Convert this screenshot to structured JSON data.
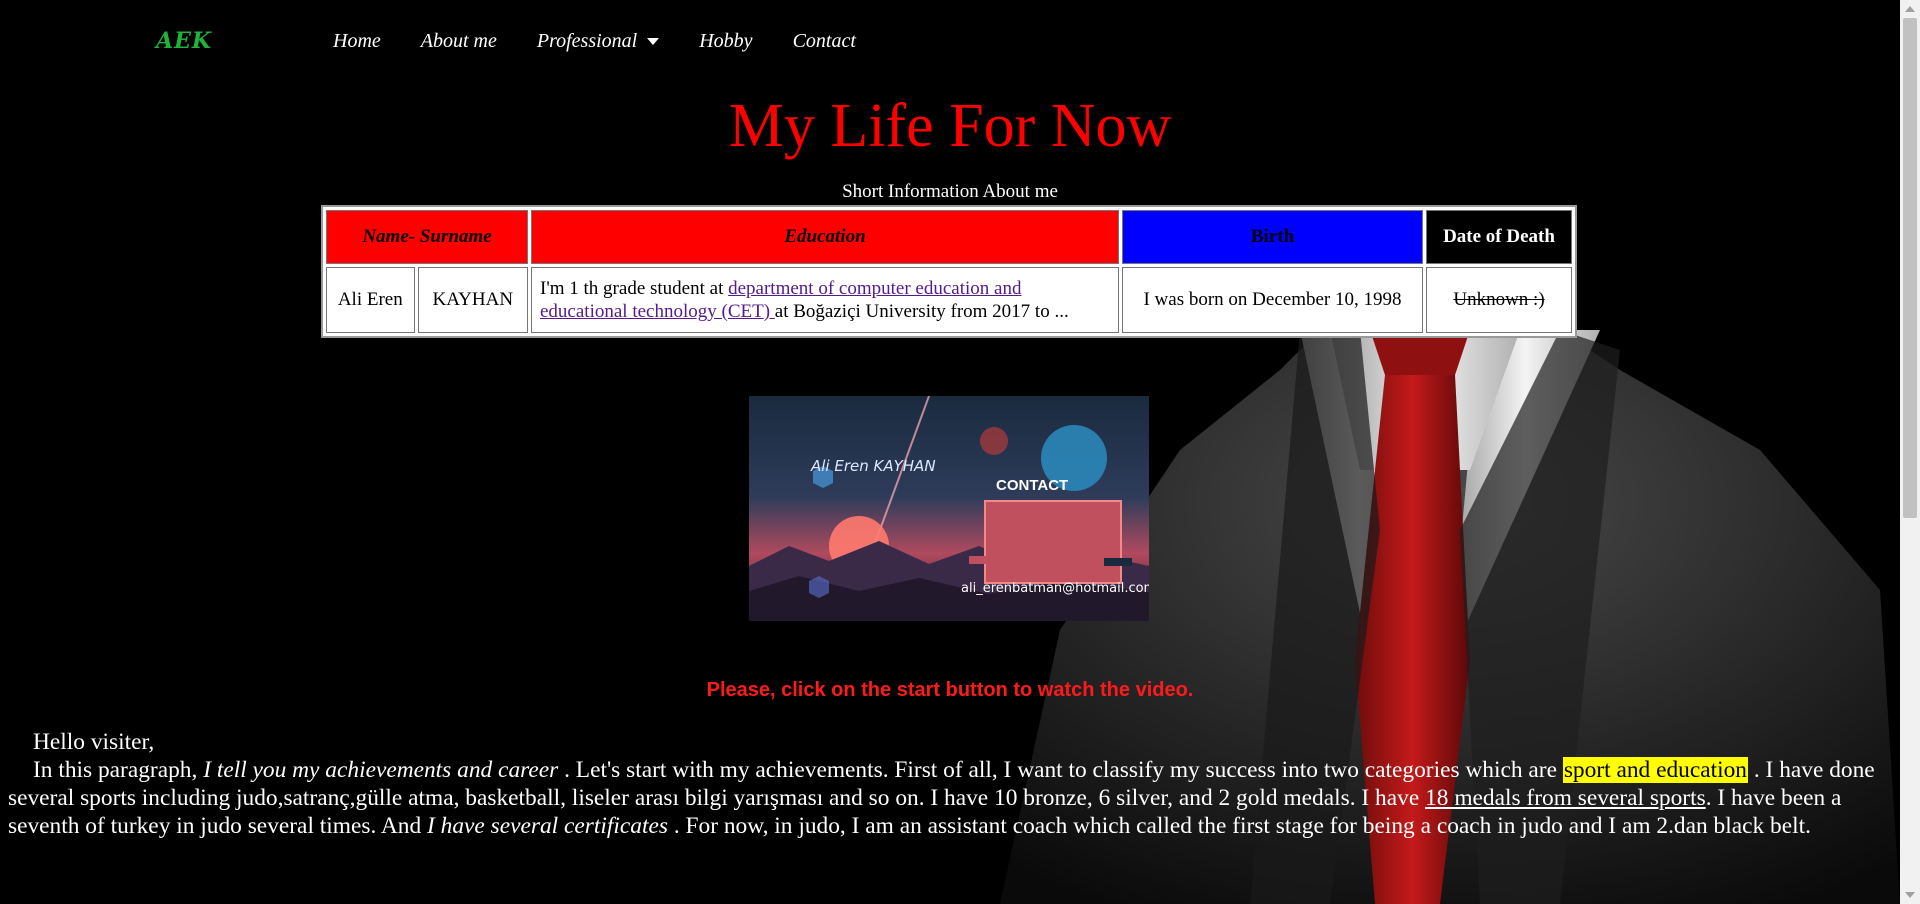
{
  "nav": {
    "logo": "AEK",
    "links": [
      "Home",
      "About me",
      "Professional",
      "Hobby",
      "Contact"
    ]
  },
  "page_title": "My Life For Now",
  "table": {
    "caption": "Short Information About me",
    "headers": {
      "name": "Name- Surname",
      "education": "Education",
      "birth": "Birth",
      "death": "Date of Death"
    },
    "row": {
      "first_name": "Ali Eren",
      "last_name": "KAYHAN",
      "edu_prefix": "I'm 1 th grade student at ",
      "edu_link": "department of computer education and educational technology (CET) ",
      "edu_suffix": "at Boğaziçi University from 2017 to ...",
      "birth": "I was born on December 10, 1998",
      "death": "Unknown :)"
    }
  },
  "contact_card": {
    "name": "Ali Eren KAYHAN",
    "label": "CONTACT",
    "email": "ali_erenbatman@hotmail.com"
  },
  "video_prompt": "Please, click on the start button to watch the video.",
  "paragraph": {
    "greeting": "Hello visiter,",
    "p1": "In this paragraph, ",
    "p1_italic": "I tell you my achievements and career",
    "p2": " . Let's start with my achievements. First of all, I want to classify my success into two categories which are ",
    "highlight": "sport and education",
    "p3": " . I have done several sports including judo,satranç,gülle atma, basketball, liseler arası bilgi yarışması and so on. I have 10 bronze, 6 silver, and 2 gold medals. I have ",
    "underlined": "18 medals from several sports",
    "p4": ". I have been a seventh of turkey in judo several times. And ",
    "p4_italic": "I have several certificates",
    "p5": " . For now, in judo, I am an assistant coach which called the first stage for being a coach in judo and I am 2.dan black belt."
  },
  "colors": {
    "title": "#ff0000",
    "logo": "#1db33c",
    "header_red": "#ff0000",
    "header_blue": "#0000ff",
    "highlight": "#ffff00"
  }
}
